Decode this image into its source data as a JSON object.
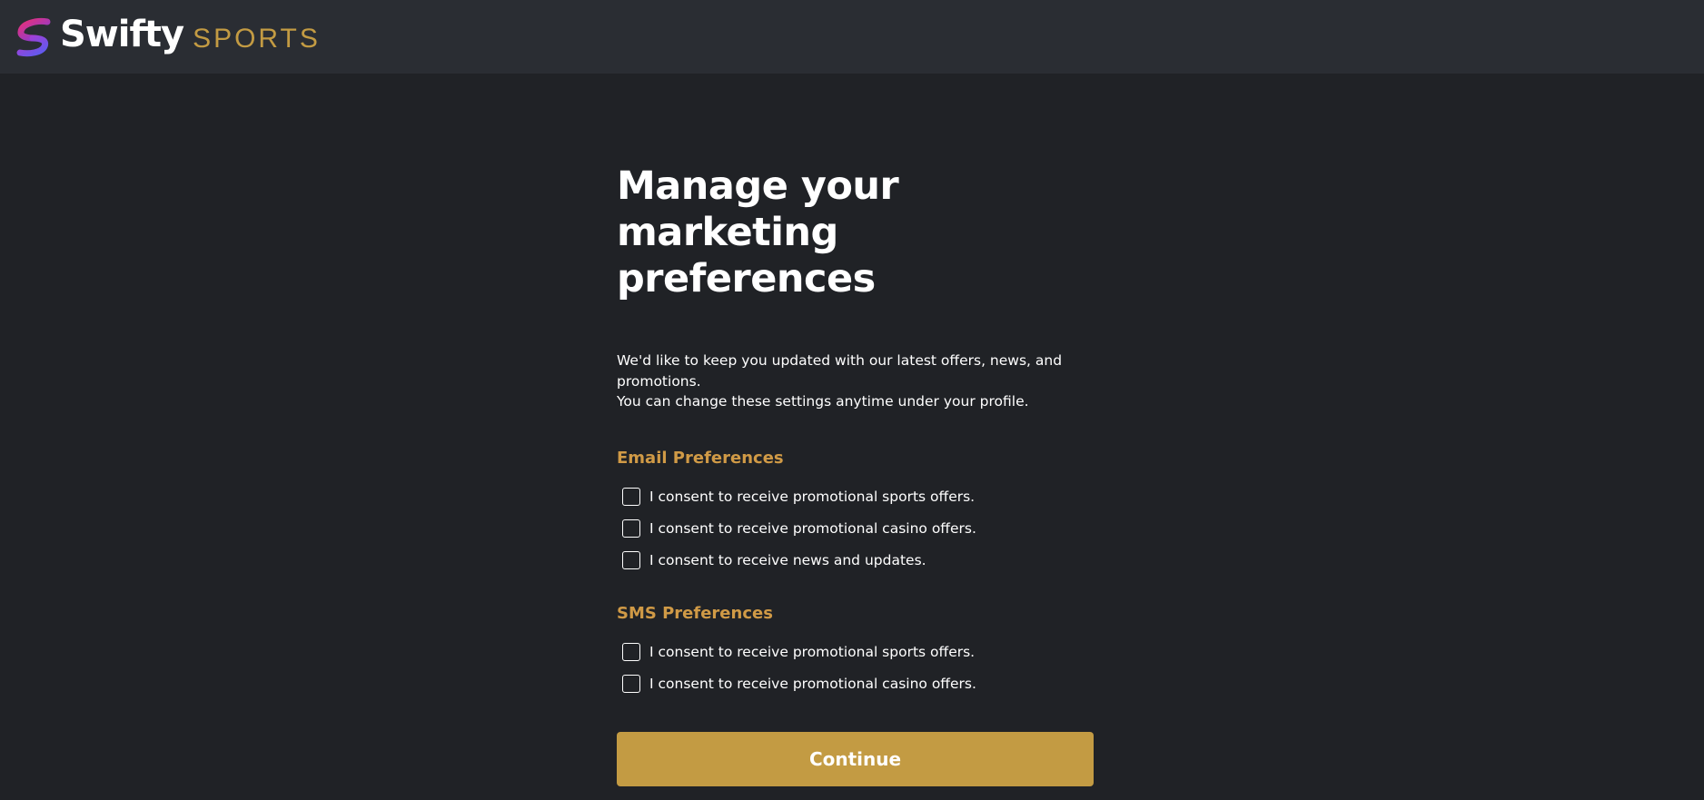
{
  "header": {
    "brand_name": "Swifty",
    "brand_sub": "SPORTS",
    "logo_icon": "swifty-s-logo",
    "colors": {
      "background": "#2a2d33",
      "brand_accent": "#c39b43"
    }
  },
  "main": {
    "title_line1": "Manage your",
    "title_line2": "marketing preferences",
    "intro_line1": "We'd like to keep you updated with our latest offers, news, and",
    "intro_line2": "promotions.",
    "intro_line3": "You can change these settings anytime under your profile.",
    "email": {
      "title": "Email Preferences",
      "options": [
        {
          "label": "I consent to receive promotional sports offers.",
          "checked": false
        },
        {
          "label": "I consent to receive promotional casino offers.",
          "checked": false
        },
        {
          "label": "I consent to receive news and updates.",
          "checked": false
        }
      ]
    },
    "sms": {
      "title": "SMS Preferences",
      "options": [
        {
          "label": "I consent to receive promotional sports offers.",
          "checked": false
        },
        {
          "label": "I consent to receive promotional casino offers.",
          "checked": false
        }
      ]
    },
    "continue_label": "Continue",
    "colors": {
      "page_background": "#202226",
      "section_title": "#d09a46",
      "button": "#c39b43"
    }
  }
}
